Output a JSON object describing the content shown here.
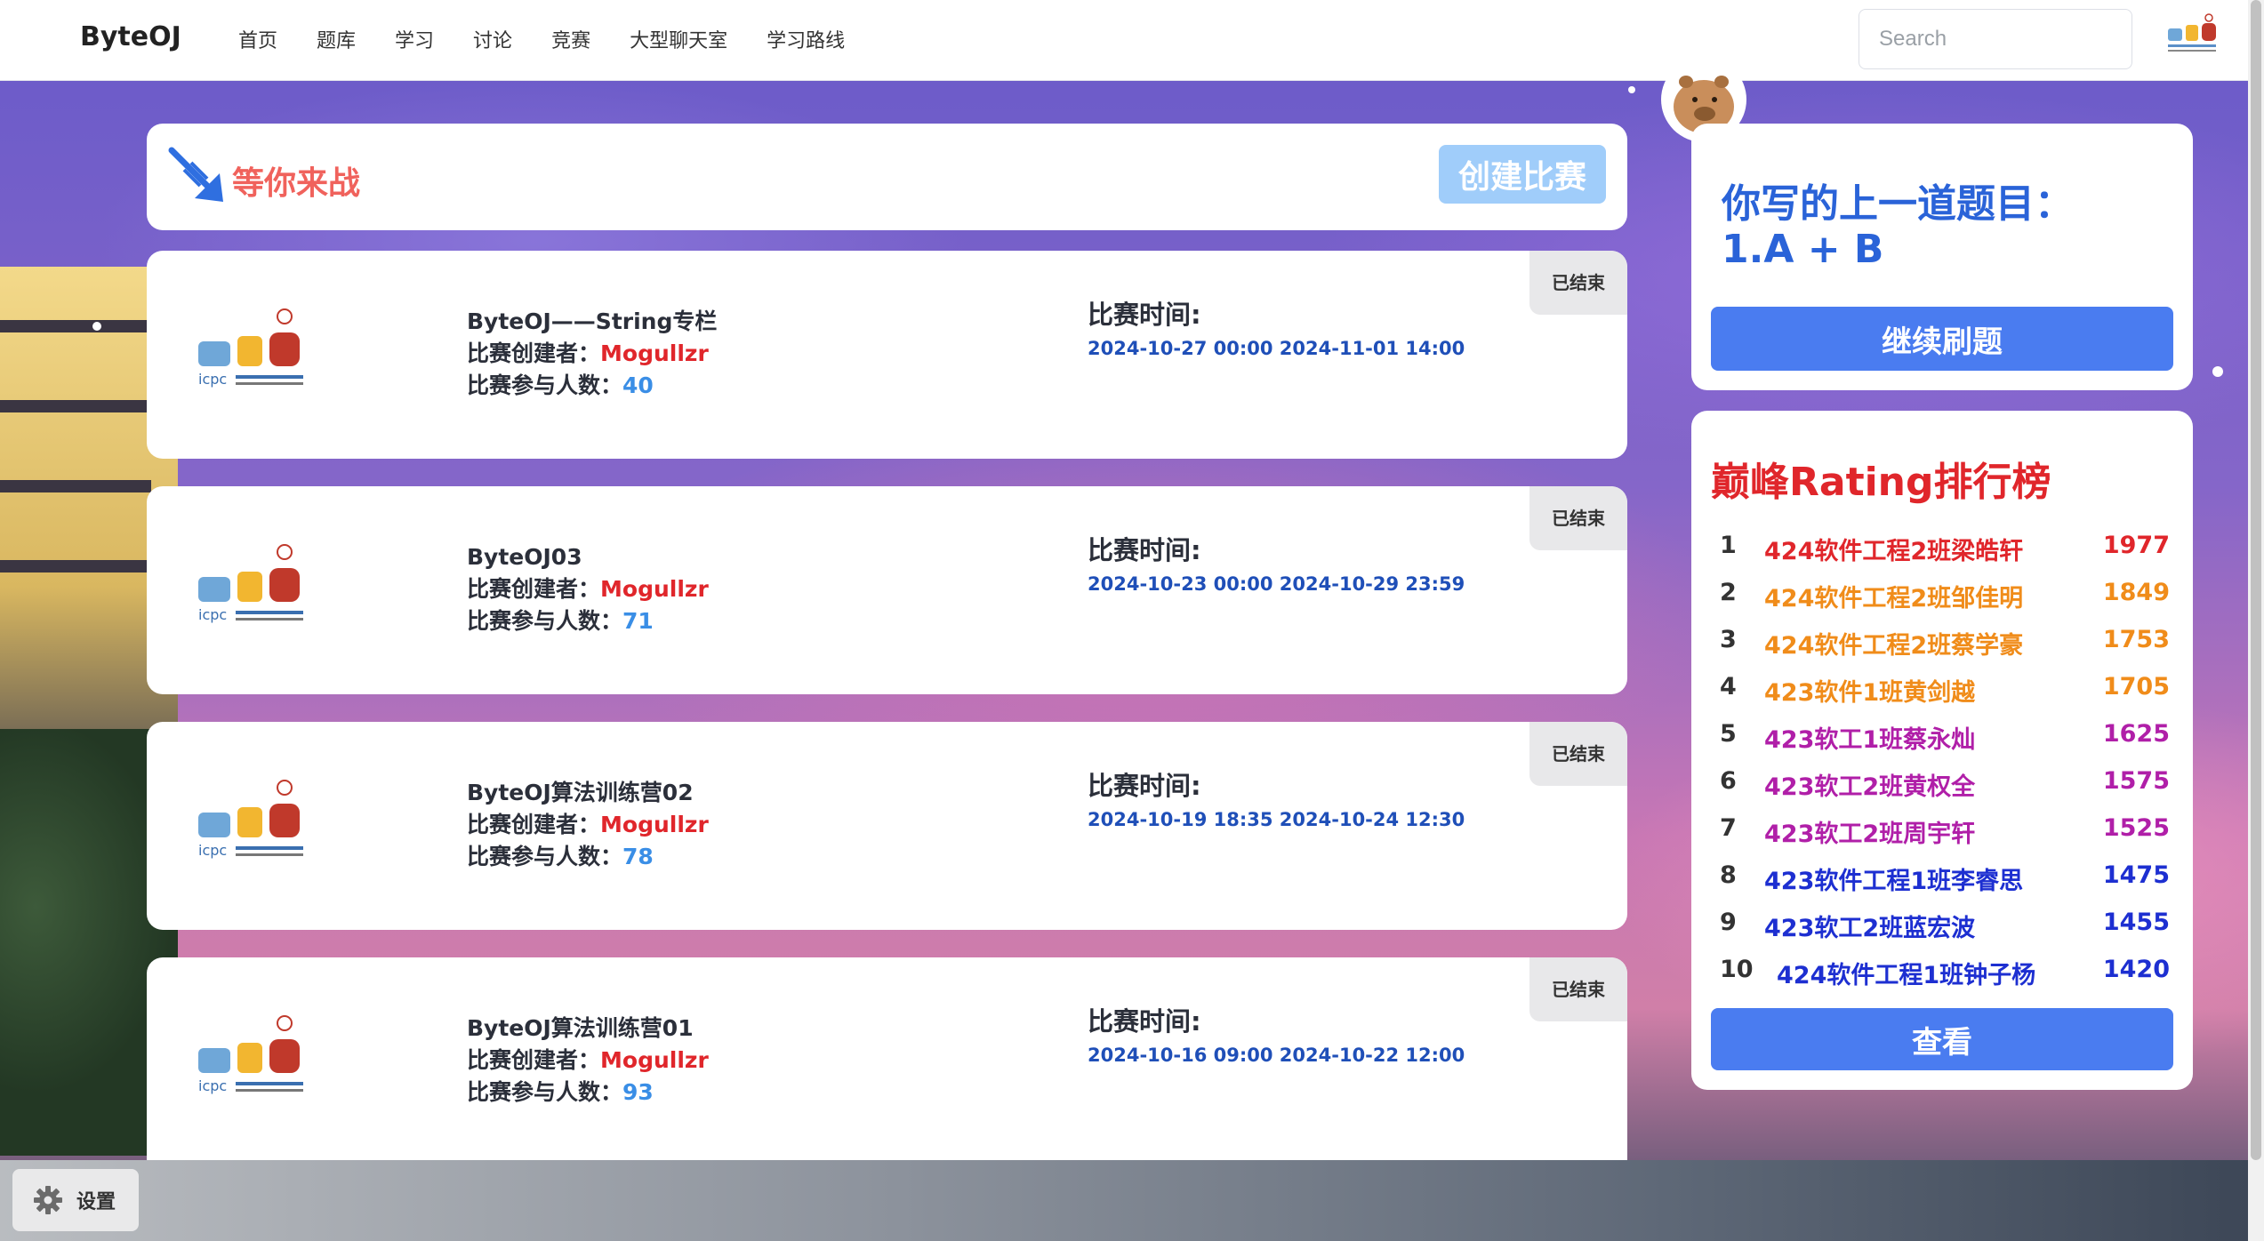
{
  "brand": "ByteOJ",
  "nav": {
    "items": [
      "首页",
      "题库",
      "学习",
      "讨论",
      "竞赛",
      "大型聊天室",
      "学习路线"
    ]
  },
  "search": {
    "placeholder": "Search"
  },
  "banner": {
    "title": "等你来战",
    "create_label": "创建比赛"
  },
  "contests": [
    {
      "name": "ByteOJ——String专栏",
      "creator_label": "比赛创建者：",
      "creator": "Mogullzr",
      "participants_label": "比赛参与人数：",
      "participants": "40",
      "time_label": "比赛时间:",
      "time_range": "2024-10-27 00:00 2024-11-01 14:00",
      "status": "已结束"
    },
    {
      "name": "ByteOJ03",
      "creator_label": "比赛创建者：",
      "creator": "Mogullzr",
      "participants_label": "比赛参与人数：",
      "participants": "71",
      "time_label": "比赛时间:",
      "time_range": "2024-10-23 00:00 2024-10-29 23:59",
      "status": "已结束"
    },
    {
      "name": "ByteOJ算法训练营02",
      "creator_label": "比赛创建者：",
      "creator": "Mogullzr",
      "participants_label": "比赛参与人数：",
      "participants": "78",
      "time_label": "比赛时间:",
      "time_range": "2024-10-19 18:35 2024-10-24 12:30",
      "status": "已结束"
    },
    {
      "name": "ByteOJ算法训练营01",
      "creator_label": "比赛创建者：",
      "creator": "Mogullzr",
      "participants_label": "比赛参与人数：",
      "participants": "93",
      "time_label": "比赛时间:",
      "time_range": "2024-10-16 09:00 2024-10-22 12:00",
      "status": "已结束"
    }
  ],
  "last_problem": {
    "label": "你写的上一道题目：",
    "problem": "1.A + B",
    "continue_label": "继续刷题"
  },
  "ranking": {
    "title": "巅峰Rating排行榜",
    "rows": [
      {
        "rank": "1",
        "name": "424软件工程2班梁皓轩",
        "score": "1977",
        "color": "#e0262b"
      },
      {
        "rank": "2",
        "name": "424软件工程2班邹佳明",
        "score": "1849",
        "color": "#f08c1a"
      },
      {
        "rank": "3",
        "name": "424软件工程2班蔡学豪",
        "score": "1753",
        "color": "#f08c1a"
      },
      {
        "rank": "4",
        "name": "423软件1班黄剑越",
        "score": "1705",
        "color": "#f08c1a"
      },
      {
        "rank": "5",
        "name": "423软工1班蔡永灿",
        "score": "1625",
        "color": "#b01fa8"
      },
      {
        "rank": "6",
        "name": "423软工2班黄权全",
        "score": "1575",
        "color": "#b01fa8"
      },
      {
        "rank": "7",
        "name": "423软工2班周宇轩",
        "score": "1525",
        "color": "#b01fa8"
      },
      {
        "rank": "8",
        "name": "423软件工程1班李睿思",
        "score": "1475",
        "color": "#1d2fd1"
      },
      {
        "rank": "9",
        "name": "423软工2班蓝宏波",
        "score": "1455",
        "color": "#1d2fd1"
      },
      {
        "rank": "10",
        "name": "424软件工程1班钟子杨",
        "score": "1420",
        "color": "#1d2fd1"
      }
    ],
    "view_label": "查看"
  },
  "settings_label": "设置"
}
